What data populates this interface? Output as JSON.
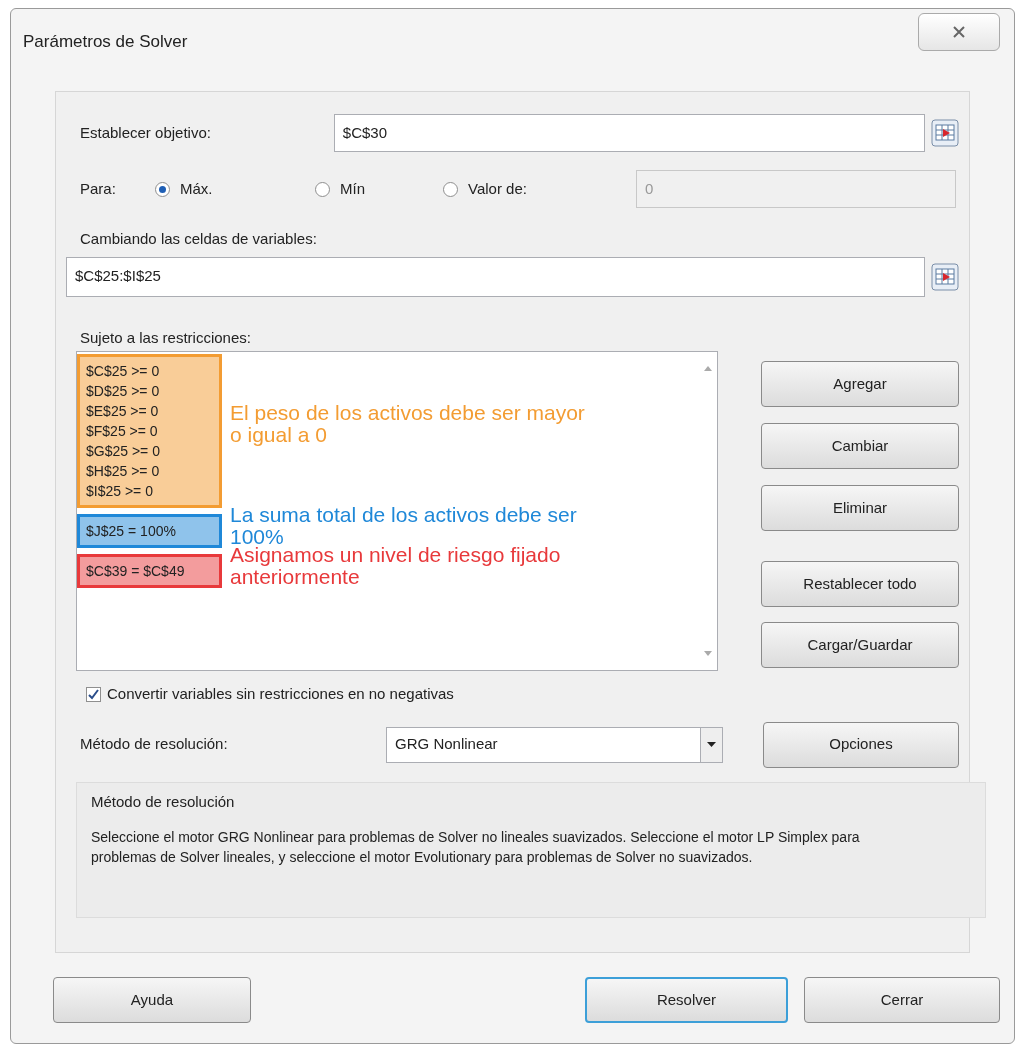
{
  "window": {
    "title": "Parámetros de Solver"
  },
  "objective": {
    "label": "Establecer objetivo:",
    "value": "$C$30"
  },
  "to": {
    "label": "Para:",
    "options": [
      {
        "label": "Máx.",
        "selected": true
      },
      {
        "label": "Mín",
        "selected": false
      },
      {
        "label": "Valor de:",
        "selected": false
      }
    ],
    "value_field": {
      "value": "0",
      "disabled": true
    }
  },
  "variables": {
    "label": "Cambiando las celdas de variables:",
    "value": "$C$25:$I$25"
  },
  "constraints": {
    "label": "Sujeto a las restricciones:",
    "groups": [
      {
        "color": "#f39c32",
        "items": [
          "$C$25 >= 0",
          "$D$25 >= 0",
          "$E$25 >= 0",
          "$F$25 >= 0",
          "$G$25 >= 0",
          "$H$25 >= 0",
          "$I$25 >= 0"
        ],
        "note_lines": [
          "El peso de los activos debe ser mayor",
          "o igual a 0"
        ]
      },
      {
        "color": "#1f88d8",
        "items": [
          "$J$25 = 100%"
        ],
        "note_lines": [
          "La suma total de los activos debe ser",
          "100%"
        ]
      },
      {
        "color": "#e8393b",
        "items": [
          "$C$39 = $C$49"
        ],
        "note_lines": [
          "Asignamos un nivel de riesgo fijado",
          "anteriormente"
        ]
      }
    ]
  },
  "side_buttons": [
    "Agregar",
    "Cambiar",
    "Eliminar",
    "Restablecer todo",
    "Cargar/Guardar"
  ],
  "nonnegative": {
    "label": "Convertir variables sin restricciones en no negativas",
    "checked": true
  },
  "method": {
    "label": "Método de resolución:",
    "value": "GRG Nonlinear",
    "options_button": "Opciones"
  },
  "description": {
    "title": "Método de resolución",
    "text": "Seleccione el motor GRG Nonlinear para problemas de Solver no lineales suavizados. Seleccione el motor LP Simplex para problemas de Solver lineales, y seleccione el motor Evolutionary para problemas de Solver no suavizados."
  },
  "bottom_buttons": [
    {
      "label": "Ayuda",
      "default": false
    },
    {
      "label": "Resolver",
      "default": true
    },
    {
      "label": "Cerrar",
      "default": false
    }
  ]
}
